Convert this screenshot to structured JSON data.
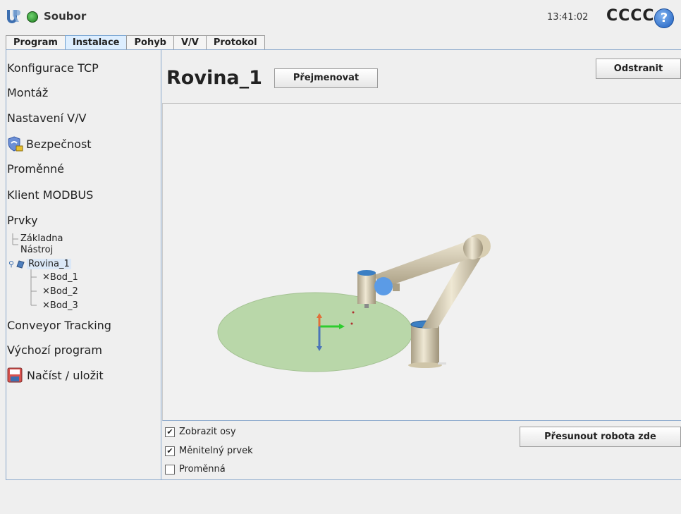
{
  "header": {
    "file_menu": "Soubor",
    "clock": "13:41:02",
    "robot_name": "CCCC",
    "help": "?"
  },
  "tabs": [
    {
      "label": "Program"
    },
    {
      "label": "Instalace"
    },
    {
      "label": "Pohyb"
    },
    {
      "label": "V/V"
    },
    {
      "label": "Protokol"
    }
  ],
  "sidebar": {
    "items": [
      {
        "label": "Konfigurace TCP"
      },
      {
        "label": "Montáž"
      },
      {
        "label": "Nastavení V/V"
      },
      {
        "label": "Bezpečnost"
      },
      {
        "label": "Proměnné"
      },
      {
        "label": "Klient MODBUS"
      },
      {
        "label": "Prvky"
      },
      {
        "label": "Conveyor Tracking"
      },
      {
        "label": "Výchozí program"
      },
      {
        "label": "Načíst / uložit"
      }
    ],
    "tree": {
      "base": "Základna",
      "tool": "Nástroj",
      "plane": "Rovina_1",
      "points": [
        "Bod_1",
        "Bod_2",
        "Bod_3"
      ]
    }
  },
  "main": {
    "title": "Rovina_1",
    "rename_button": "Přejmenovat",
    "delete_button": "Odstranit",
    "move_here_button": "Přesunout robota zde",
    "checkboxes": [
      {
        "label": "Zobrazit osy",
        "checked": true
      },
      {
        "label": "Měnitelný prvek",
        "checked": true
      },
      {
        "label": "Proměnná",
        "checked": false
      }
    ]
  },
  "colors": {
    "accent": "#8aa8cc",
    "plane": "#b9d7a9",
    "robot": "#d9cfb4",
    "robot_joint_cap": "#3b7fc4"
  }
}
